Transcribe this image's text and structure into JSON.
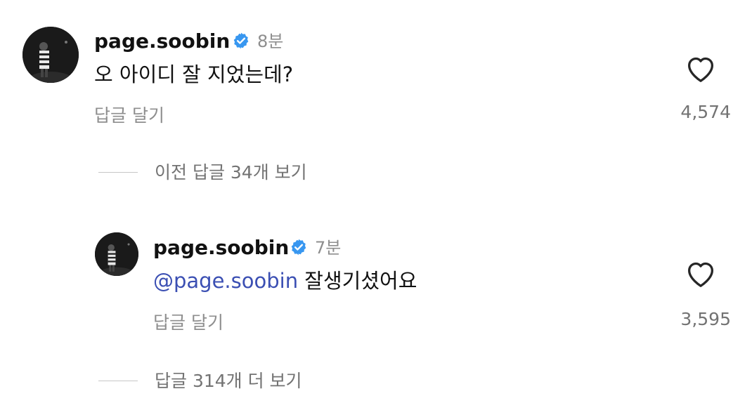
{
  "comments": [
    {
      "username": "page.soobin",
      "verified": true,
      "time": "8분",
      "text": "오 아이디 잘 지었는데?",
      "reply_label": "답글 달기",
      "likes": "4,574"
    },
    {
      "username": "page.soobin",
      "verified": true,
      "time": "7분",
      "mention": "@page.soobin",
      "text": " 잘생기셨어요",
      "reply_label": "답글 달기",
      "likes": "3,595"
    }
  ],
  "threads": {
    "previous_replies": "이전 답글 34개 보기",
    "more_replies": "답글 314개 더 보기"
  },
  "colors": {
    "verified_badge": "#3897f0",
    "mention": "#3b4fb3",
    "muted_text": "#8e8e8e"
  },
  "icons": {
    "verified": "verified-badge-icon",
    "like": "heart-outline-icon"
  }
}
